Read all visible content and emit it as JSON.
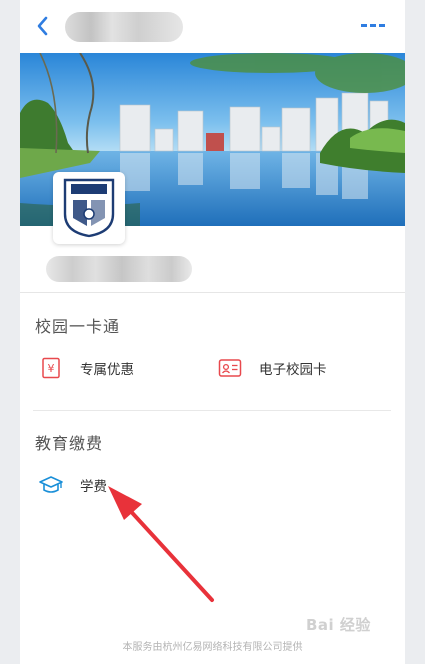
{
  "header": {
    "back_icon": "chevron-left-icon",
    "more_icon": "more-dots-icon",
    "accent_color": "#2f7de1"
  },
  "sections": [
    {
      "title": "校园一卡通",
      "items": [
        {
          "label": "专属优惠",
          "icon": "coupon-icon"
        },
        {
          "label": "电子校园卡",
          "icon": "id-card-icon"
        }
      ]
    },
    {
      "title": "教育缴费",
      "items": [
        {
          "label": "学费",
          "icon": "graduation-cap-icon"
        }
      ]
    }
  ],
  "footer": {
    "text": "本服务由杭州亿易网络科技有限公司提供"
  },
  "watermark": {
    "text": "Bai 经验"
  },
  "colors": {
    "coupon_icon": "#e8484d",
    "tuition_icon": "#1a8fd8",
    "arrow": "#e8323a"
  }
}
